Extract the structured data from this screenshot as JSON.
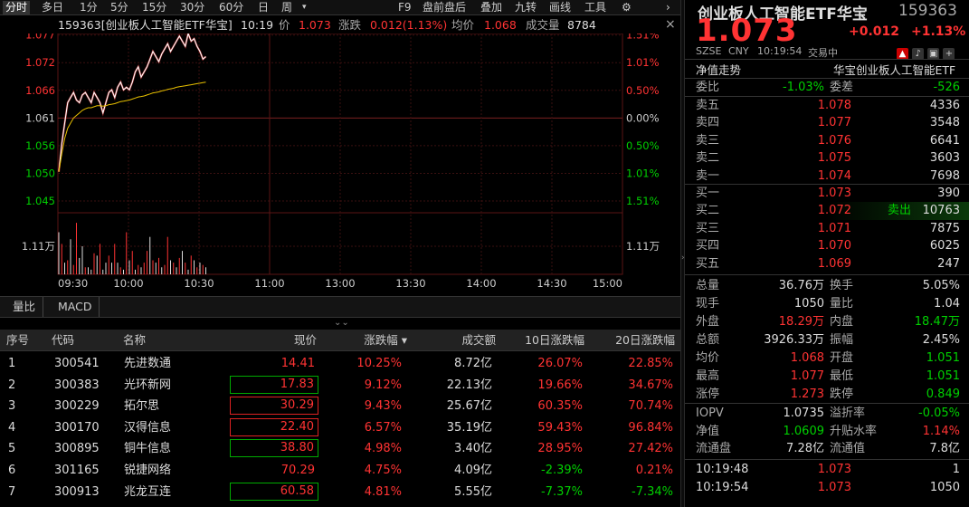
{
  "toolbar": {
    "items": [
      "分时",
      "多日",
      "1分",
      "5分",
      "15分",
      "30分",
      "60分",
      "日",
      "周",
      "▾",
      "F9",
      "盘前盘后",
      "叠加",
      "九转",
      "画线",
      "工具"
    ],
    "gear": "⚙",
    "more": "›"
  },
  "info": {
    "code_name": "159363[创业板人工智能ETF华宝]",
    "time": "10:19",
    "price_label": "价",
    "price": "1.073",
    "chg_label": "涨跌",
    "chg": "0.012(1.13%)",
    "avg_label": "均价",
    "avg": "1.068",
    "vol_label": "成交量",
    "vol": "8784",
    "close_icon": "×"
  },
  "chart_data": {
    "type": "line",
    "title": "",
    "prev_close": 1.061,
    "y_left_ticks": [
      "1.077",
      "1.072",
      "1.066",
      "1.061",
      "1.056",
      "1.050",
      "1.045",
      "1.11万"
    ],
    "y_right_ticks": [
      "1.51%",
      "1.01%",
      "0.50%",
      "0.00%",
      "0.50%",
      "1.01%",
      "1.51%",
      "1.11万"
    ],
    "x_ticks": [
      "09:30",
      "10:00",
      "10:30",
      "11:00",
      "13:00",
      "13:30",
      "14:00",
      "14:30",
      "15:00"
    ],
    "series": [
      {
        "color": "#ffffff",
        "values": [
          1.0505,
          1.056,
          1.06,
          1.064,
          1.065,
          1.066,
          1.0645,
          1.064,
          1.0655,
          1.066,
          1.065,
          1.064,
          1.066,
          1.065,
          1.064,
          1.062,
          1.064,
          1.066,
          1.0665,
          1.065,
          1.067,
          1.068,
          1.0665,
          1.067,
          1.0665,
          1.068,
          1.07,
          1.071,
          1.069,
          1.07,
          1.071,
          1.0725,
          1.074,
          1.073,
          1.072,
          1.0735,
          1.0745,
          1.0755,
          1.074,
          1.075,
          1.076,
          1.077,
          1.076,
          1.075,
          1.0775,
          1.076,
          1.0765,
          1.075,
          1.074,
          1.0725,
          1.073
        ]
      },
      {
        "color": "#e8c000",
        "values": [
          1.0505,
          1.054,
          1.057,
          1.059,
          1.06,
          1.061,
          1.0615,
          1.062,
          1.0625,
          1.0628,
          1.063,
          1.063,
          1.0632,
          1.0634,
          1.0634,
          1.0633,
          1.0634,
          1.0636,
          1.0637,
          1.0638,
          1.064,
          1.0642,
          1.0643,
          1.0644,
          1.0645,
          1.0647,
          1.0649,
          1.0651,
          1.0652,
          1.0653,
          1.0655,
          1.0657,
          1.0659,
          1.066,
          1.0661,
          1.0663,
          1.0664,
          1.0666,
          1.0667,
          1.0668,
          1.067,
          1.0671,
          1.0672,
          1.0673,
          1.0674,
          1.0675,
          1.0676,
          1.0677,
          1.0678,
          1.0679,
          1.068
        ]
      }
    ],
    "volume": [
      9000,
      6500,
      2500,
      3000,
      7500,
      2000,
      11000,
      3500,
      6000,
      1500,
      1500,
      1000,
      4500,
      4000,
      6500,
      1000,
      2500,
      4000,
      2500,
      6500,
      2500,
      1500,
      1000,
      9000,
      3000,
      5000,
      1000,
      2000,
      1500,
      2500,
      5000,
      8000,
      3000,
      2500,
      3500,
      1500,
      2000,
      8000,
      3000,
      2500,
      1500,
      3500,
      5000,
      2500,
      1000,
      4000,
      3000,
      1500,
      2500,
      2000,
      1500
    ],
    "volume_colors": [
      "w",
      "r",
      "w",
      "r",
      "w",
      "r",
      "r",
      "w",
      "w",
      "r",
      "w",
      "w",
      "r",
      "w",
      "r",
      "w",
      "w",
      "r",
      "w",
      "r",
      "w",
      "r",
      "w",
      "r",
      "w",
      "r",
      "w",
      "r",
      "w",
      "r",
      "r",
      "w",
      "r",
      "w",
      "r",
      "w",
      "r",
      "r",
      "w",
      "r",
      "w",
      "r",
      "w",
      "r",
      "w",
      "r",
      "w",
      "r",
      "w",
      "r",
      "w"
    ]
  },
  "bottom_tabs": [
    "量比",
    "MACD"
  ],
  "table": {
    "headers": [
      "序号",
      "代码",
      "名称",
      "现价",
      "涨跌幅 ▾",
      "成交额",
      "10日涨跌幅",
      "20日涨跌幅"
    ],
    "rows": [
      {
        "idx": "1",
        "code": "300541",
        "name": "先进数通",
        "price": "14.41",
        "pct": "10.25%",
        "amt": "8.72亿",
        "d10": "26.07%",
        "d20": "22.85%",
        "pc": "red",
        "box": "",
        "c10": "red",
        "c20": "red"
      },
      {
        "idx": "2",
        "code": "300383",
        "name": "光环新网",
        "price": "17.83",
        "pct": "9.12%",
        "amt": "22.13亿",
        "d10": "19.66%",
        "d20": "34.67%",
        "pc": "red",
        "box": "g",
        "c10": "red",
        "c20": "red"
      },
      {
        "idx": "3",
        "code": "300229",
        "name": "拓尔思",
        "price": "30.29",
        "pct": "9.43%",
        "amt": "25.67亿",
        "d10": "60.35%",
        "d20": "70.74%",
        "pc": "red",
        "box": "r",
        "c10": "red",
        "c20": "red"
      },
      {
        "idx": "4",
        "code": "300170",
        "name": "汉得信息",
        "price": "22.40",
        "pct": "6.57%",
        "amt": "35.19亿",
        "d10": "59.43%",
        "d20": "96.84%",
        "pc": "red",
        "box": "r",
        "c10": "red",
        "c20": "red"
      },
      {
        "idx": "5",
        "code": "300895",
        "name": "铜牛信息",
        "price": "38.80",
        "pct": "4.98%",
        "amt": "3.40亿",
        "d10": "28.95%",
        "d20": "27.42%",
        "pc": "red",
        "box": "g",
        "c10": "red",
        "c20": "red"
      },
      {
        "idx": "6",
        "code": "301165",
        "name": "锐捷网络",
        "price": "70.29",
        "pct": "4.75%",
        "amt": "4.09亿",
        "d10": "-2.39%",
        "d20": "0.21%",
        "pc": "red",
        "box": "",
        "c10": "green",
        "c20": "red"
      },
      {
        "idx": "7",
        "code": "300913",
        "name": "兆龙互连",
        "price": "60.58",
        "pct": "4.81%",
        "amt": "5.55亿",
        "d10": "-7.37%",
        "d20": "-7.34%",
        "pc": "red",
        "box": "g",
        "c10": "green",
        "c20": "green"
      }
    ]
  },
  "right": {
    "title": "创业板人工智能ETF华宝",
    "code": "159363",
    "price": "1.073",
    "chg": "+0.012",
    "pct": "+1.13%",
    "sub": [
      "SZSE",
      "CNY",
      "10:19:54",
      "交易中"
    ],
    "nav_label": "净值走势",
    "nav_name": "华宝创业板人工智能ETF",
    "weibi_label": "委比",
    "weibi": "-1.03%",
    "weicha_label": "委差",
    "weicha": "-526",
    "asks": [
      {
        "l": "卖五",
        "p": "1.078",
        "v": "4336"
      },
      {
        "l": "卖四",
        "p": "1.077",
        "v": "3548"
      },
      {
        "l": "卖三",
        "p": "1.076",
        "v": "6641"
      },
      {
        "l": "卖二",
        "p": "1.075",
        "v": "3603"
      },
      {
        "l": "卖一",
        "p": "1.074",
        "v": "7698"
      }
    ],
    "bids": [
      {
        "l": "买一",
        "p": "1.073",
        "v": "390",
        "note": ""
      },
      {
        "l": "买二",
        "p": "1.072",
        "v": "10763",
        "note": "卖出"
      },
      {
        "l": "买三",
        "p": "1.071",
        "v": "7875",
        "note": ""
      },
      {
        "l": "买四",
        "p": "1.070",
        "v": "6025",
        "note": ""
      },
      {
        "l": "买五",
        "p": "1.069",
        "v": "247",
        "note": ""
      }
    ],
    "stats": [
      {
        "a": "总量",
        "av": "36.76万",
        "ac": "white",
        "b": "换手",
        "bv": "5.05%",
        "bc": "white"
      },
      {
        "a": "现手",
        "av": "1050",
        "ac": "white",
        "b": "量比",
        "bv": "1.04",
        "bc": "white"
      },
      {
        "a": "外盘",
        "av": "18.29万",
        "ac": "red",
        "b": "内盘",
        "bv": "18.47万",
        "bc": "green"
      },
      {
        "a": "总额",
        "av": "3926.33万",
        "ac": "white",
        "b": "振幅",
        "bv": "2.45%",
        "bc": "white"
      },
      {
        "a": "均价",
        "av": "1.068",
        "ac": "red",
        "b": "开盘",
        "bv": "1.051",
        "bc": "green"
      },
      {
        "a": "最高",
        "av": "1.077",
        "ac": "red",
        "b": "最低",
        "bv": "1.051",
        "bc": "green"
      },
      {
        "a": "涨停",
        "av": "1.273",
        "ac": "red",
        "b": "跌停",
        "bv": "0.849",
        "bc": "green"
      }
    ],
    "iopv": [
      {
        "a": "IOPV",
        "av": "1.0735",
        "ac": "white",
        "b": "溢折率",
        "bv": "-0.05%",
        "bc": "green"
      },
      {
        "a": "净值",
        "av": "1.0609",
        "ac": "green",
        "b": "升贴水率",
        "bv": "1.14%",
        "bc": "red"
      },
      {
        "a": "流通盘",
        "av": "7.28亿",
        "ac": "white",
        "b": "流通值",
        "bv": "7.8亿",
        "bc": "white"
      }
    ],
    "ticks": [
      {
        "t": "10:19:48",
        "p": "1.073",
        "v": "1"
      },
      {
        "t": "10:19:54",
        "p": "1.073",
        "v": "1050"
      }
    ]
  },
  "colors": {
    "up": "#ff3333",
    "down": "#00d000",
    "bg": "#000000",
    "grid": "#3a1010"
  }
}
